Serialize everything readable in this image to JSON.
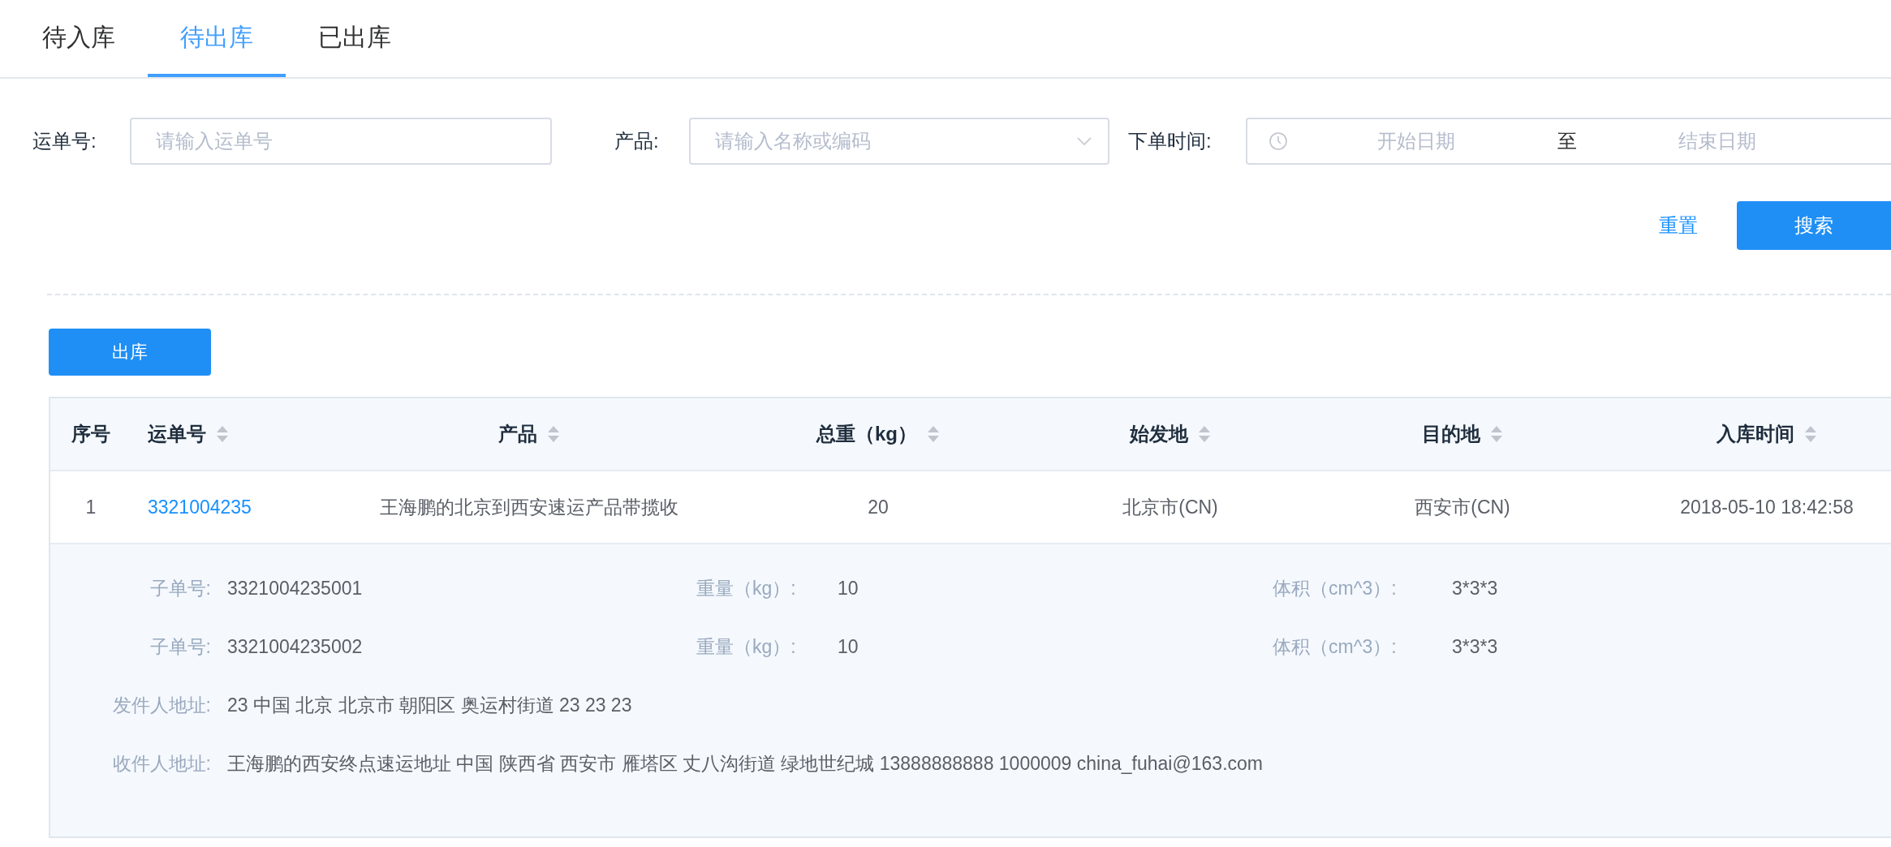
{
  "tabs": [
    {
      "label": "待入库",
      "selected": false
    },
    {
      "label": "待出库",
      "selected": true
    },
    {
      "label": "已出库",
      "selected": false
    }
  ],
  "filters": {
    "waybill": {
      "label": "运单号:",
      "placeholder": "请输入运单号"
    },
    "product": {
      "label": "产品:",
      "placeholder": "请输入名称或编码"
    },
    "order_time": {
      "label": "下单时间:",
      "start_placeholder": "开始日期",
      "separator": "至",
      "end_placeholder": "结束日期"
    }
  },
  "actions": {
    "reset": "重置",
    "search": "搜索"
  },
  "toolbar": {
    "outbound_button": "出库"
  },
  "table": {
    "columns": [
      {
        "label": "序号",
        "sortable": false
      },
      {
        "label": "运单号",
        "sortable": true
      },
      {
        "label": "产品",
        "sortable": true
      },
      {
        "label": "总重（kg）",
        "sortable": true
      },
      {
        "label": "始发地",
        "sortable": true
      },
      {
        "label": "目的地",
        "sortable": true
      },
      {
        "label": "入库时间",
        "sortable": true
      }
    ],
    "rows": [
      {
        "index": "1",
        "waybill": "3321004235",
        "product": "王海鹏的北京到西安速运产品带揽收",
        "weight": "20",
        "origin": "北京市(CN)",
        "destination": "西安市(CN)",
        "time": "2018-05-10 18:42:58",
        "details": {
          "sub_orders": [
            {
              "label": "子单号:",
              "value": "3321004235001",
              "weight_label": "重量（kg）:",
              "weight": "10",
              "volume_label": "体积（cm^3）:",
              "volume": "3*3*3"
            },
            {
              "label": "子单号:",
              "value": "3321004235002",
              "weight_label": "重量（kg）:",
              "weight": "10",
              "volume_label": "体积（cm^3）:",
              "volume": "3*3*3"
            }
          ],
          "sender": {
            "label": "发件人地址:",
            "value": "23 中国 北京 北京市 朝阳区 奥运村街道 23 23 23"
          },
          "receiver": {
            "label": "收件人地址:",
            "value": "王海鹏的西安终点速运地址 中国 陕西省 西安市 雁塔区 丈八沟街道 绿地世纪城 13888888888 1000009 china_fuhai@163.com"
          }
        }
      }
    ]
  }
}
